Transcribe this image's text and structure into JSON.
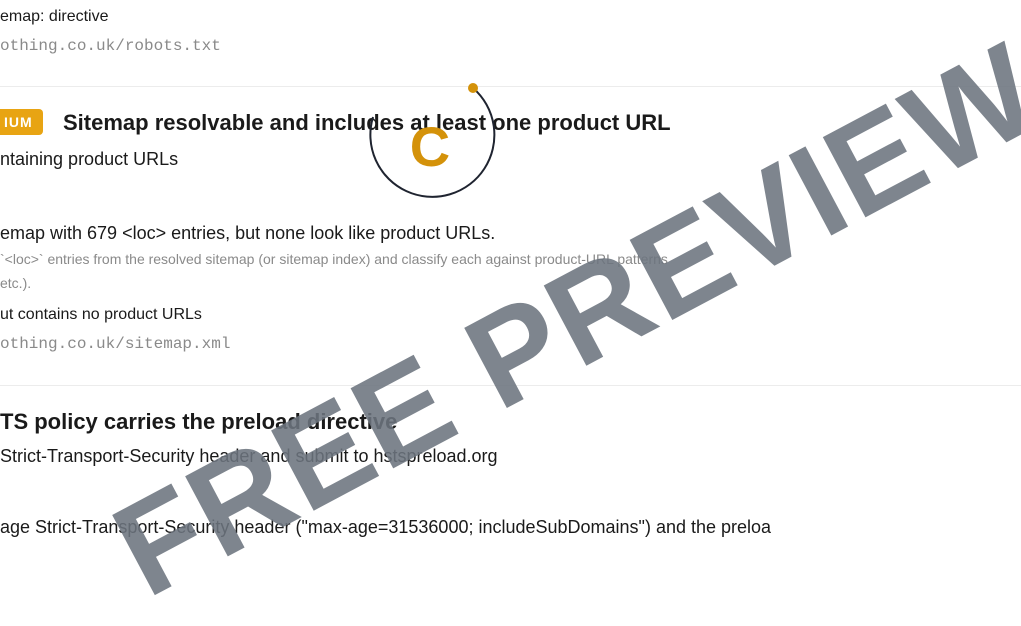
{
  "section1": {
    "label": "emap: directive",
    "url": "othing.co.uk/robots.txt"
  },
  "section2": {
    "badge": "IUM",
    "title": "Sitemap resolvable and includes at least one product URL",
    "subtitle": "ntaining product URLs",
    "finding": "emap with 679 <loc> entries, but none look like product URLs.",
    "method_line1": " `<loc>` entries from the resolved sitemap (or sitemap index) and classify each against product-URL patterns",
    "method_line2": "etc.).",
    "evidence_label": "ut contains no product URLs",
    "evidence_url": "othing.co.uk/sitemap.xml"
  },
  "section3": {
    "title": "TS policy carries the preload directive",
    "subtitle": " Strict-Transport-Security header and submit to hstspreload.org",
    "finding": "age Strict-Transport-Security header (\"max-age=31536000; includeSubDomains\") and the preloa"
  },
  "logo": {
    "letter": "C",
    "accent": "#d4920a",
    "ring": "#1f2430"
  },
  "watermark": {
    "text": "FREE PREVIEW",
    "color": "#6c747e"
  }
}
